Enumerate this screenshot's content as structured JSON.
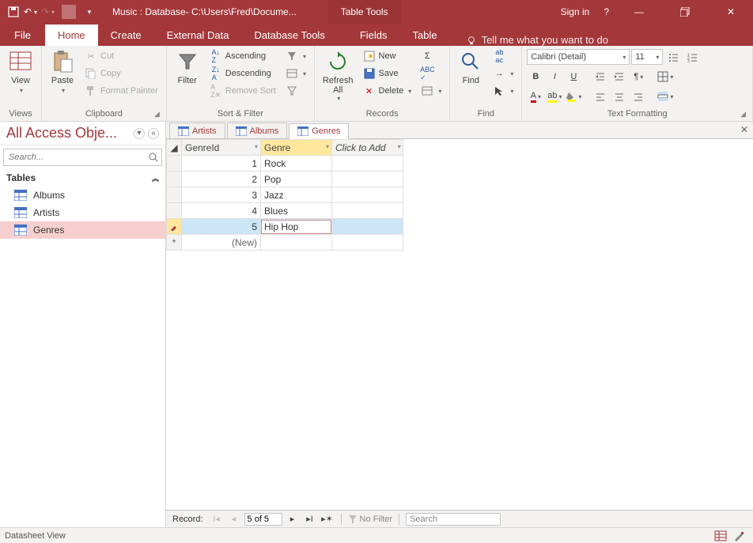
{
  "titlebar": {
    "title": "Music : Database- C:\\Users\\Fred\\Docume...",
    "contextual": "Table Tools",
    "signin": "Sign in"
  },
  "tabs": {
    "file": "File",
    "home": "Home",
    "create": "Create",
    "external": "External Data",
    "dbtools": "Database Tools",
    "fields": "Fields",
    "table": "Table",
    "tellme": "Tell me what you want to do"
  },
  "ribbon": {
    "views": {
      "view": "View",
      "label": "Views"
    },
    "clipboard": {
      "paste": "Paste",
      "cut": "Cut",
      "copy": "Copy",
      "format_painter": "Format Painter",
      "label": "Clipboard"
    },
    "sortfilter": {
      "filter": "Filter",
      "asc": "Ascending",
      "desc": "Descending",
      "remove": "Remove Sort",
      "label": "Sort & Filter"
    },
    "records": {
      "refresh": "Refresh\nAll",
      "new": "New",
      "save": "Save",
      "delete": "Delete",
      "label": "Records"
    },
    "find": {
      "find": "Find",
      "label": "Find"
    },
    "textfmt": {
      "font": "Calibri (Detail)",
      "size": "11",
      "label": "Text Formatting"
    }
  },
  "nav": {
    "title": "All Access Obje...",
    "search_placeholder": "Search...",
    "group": "Tables",
    "items": [
      "Albums",
      "Artists",
      "Genres"
    ],
    "selected": 2
  },
  "doctabs": [
    "Artists",
    "Albums",
    "Genres"
  ],
  "doctab_active": 2,
  "grid": {
    "columns": [
      "GenreId",
      "Genre",
      "Click to Add"
    ],
    "rows": [
      {
        "id": "1",
        "val": "Rock"
      },
      {
        "id": "2",
        "val": "Pop"
      },
      {
        "id": "3",
        "val": "Jazz"
      },
      {
        "id": "4",
        "val": "Blues"
      },
      {
        "id": "5",
        "val": "Hip Hop",
        "editing": true
      }
    ],
    "new_label": "(New)"
  },
  "recnav": {
    "label": "Record:",
    "pos": "5 of 5",
    "nofilter": "No Filter",
    "search": "Search"
  },
  "status": {
    "view": "Datasheet View"
  }
}
